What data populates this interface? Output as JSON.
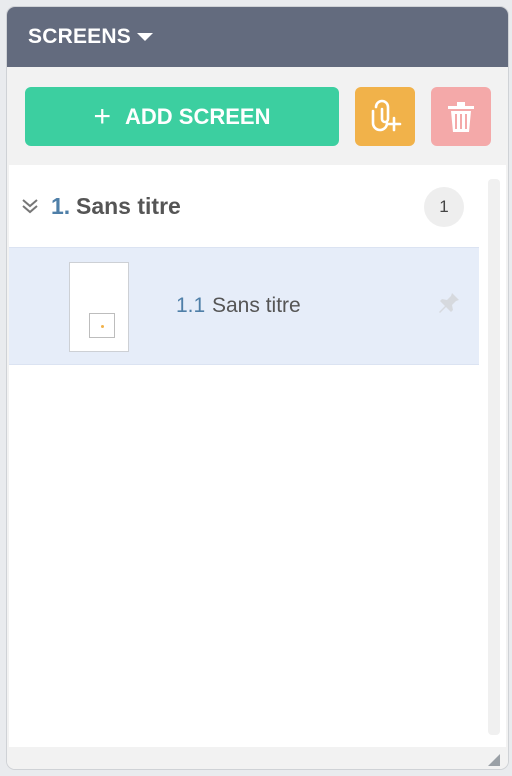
{
  "header": {
    "title": "SCREENS",
    "caret_icon": "chevron-down-icon"
  },
  "toolbar": {
    "add_label": "ADD SCREEN",
    "add_icon": "plus-icon",
    "link_icon": "link-plus-icon",
    "delete_icon": "trash-icon",
    "colors": {
      "add": "#3ccfa0",
      "link": "#f1b24a",
      "delete": "#f4a9a9"
    }
  },
  "group": {
    "number": "1.",
    "name": "Sans titre",
    "count": "1",
    "expand_icon": "double-chevron-down-icon"
  },
  "screens": [
    {
      "number": "1.1",
      "name": "Sans titre",
      "pin_icon": "pin-icon",
      "selected": true
    }
  ],
  "colors": {
    "header_bg": "#636b7e",
    "accent_blue": "#4f7fa8",
    "selected_row": "#e6edf9"
  }
}
